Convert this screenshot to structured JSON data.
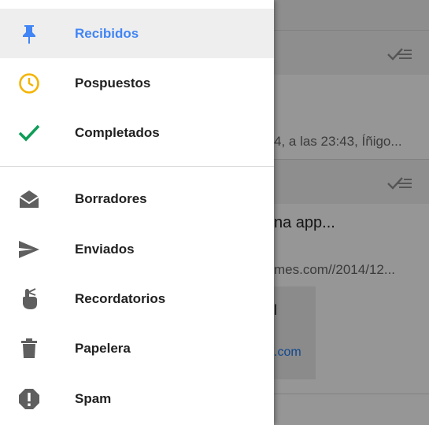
{
  "background": {
    "preview_1": "4, a las 23:43, Íñigo...",
    "subject_2": "na app...",
    "preview_2": "mes.com//2014/12...",
    "card_text": "l",
    "card_link": ".com"
  },
  "drawer": {
    "items": [
      {
        "label": "Recibidos",
        "icon": "pin-icon",
        "color": "#4285f4"
      },
      {
        "label": "Pospuestos",
        "icon": "clock-icon",
        "color": "#f4b400"
      },
      {
        "label": "Completados",
        "icon": "check-icon",
        "color": "#0f9d58"
      },
      {
        "label": "Borradores",
        "icon": "drafts-icon",
        "color": "#5f5f5f"
      },
      {
        "label": "Enviados",
        "icon": "send-icon",
        "color": "#5f5f5f"
      },
      {
        "label": "Recordatorios",
        "icon": "reminder-finger-icon",
        "color": "#5f5f5f"
      },
      {
        "label": "Papelera",
        "icon": "trash-icon",
        "color": "#5f5f5f"
      },
      {
        "label": "Spam",
        "icon": "spam-icon",
        "color": "#5f5f5f"
      }
    ]
  }
}
